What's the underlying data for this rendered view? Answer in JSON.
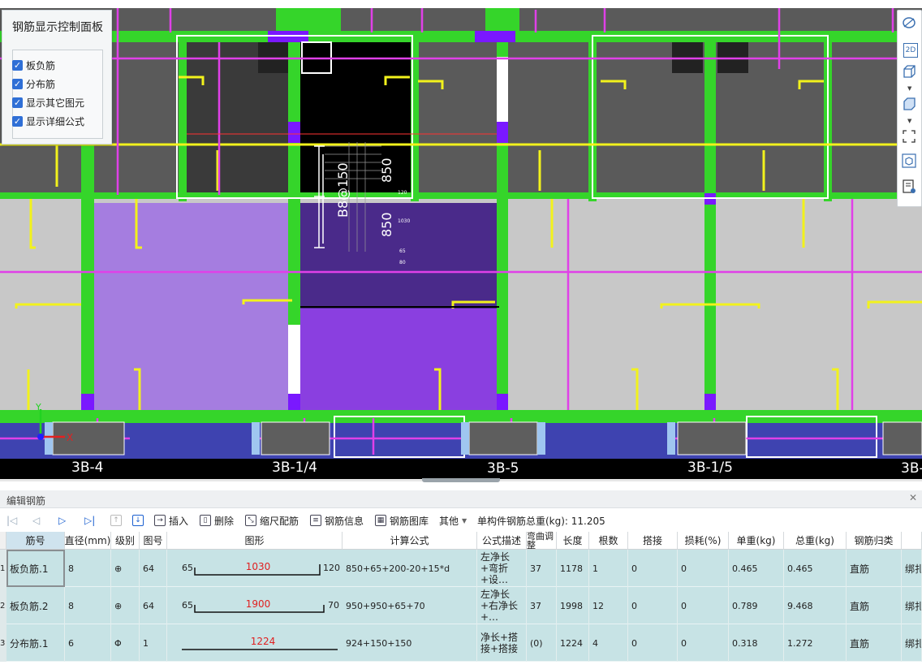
{
  "panel": {
    "title": "钢筋显示控制面板",
    "options": [
      {
        "label": "板负筋",
        "checked": true
      },
      {
        "label": "分布筋",
        "checked": true
      },
      {
        "label": "显示其它图元",
        "checked": true
      },
      {
        "label": "显示详细公式",
        "checked": true
      }
    ]
  },
  "viewport": {
    "axis_labels": [
      "3B-4",
      "3B-1/4",
      "3B-5",
      "3B-1/5",
      "3B-"
    ],
    "dims": [
      "850",
      "850",
      "B8@150",
      "120",
      "1030",
      "65",
      "80"
    ],
    "triad": {
      "x": "X",
      "y": "Y"
    }
  },
  "view_toolbar": {
    "items": [
      "orbit-icon",
      "2d-view-icon",
      "3d-box-icon",
      "3d-solid-icon",
      "fullscreen-icon",
      "object-view-icon",
      "list-view-icon"
    ],
    "label_2d": "2D"
  },
  "editor": {
    "title": "编辑钢筋",
    "toolbar": {
      "insert": "插入",
      "delete": "删除",
      "scale": "缩尺配筋",
      "info": "钢筋信息",
      "library": "钢筋图库",
      "other": "其他",
      "total_weight": "单构件钢筋总重(kg): 11.205"
    },
    "columns": [
      "筋号",
      "直径(mm)",
      "级别",
      "图号",
      "图形",
      "计算公式",
      "公式描述",
      "弯曲调整",
      "长度",
      "根数",
      "搭接",
      "损耗(%)",
      "单重(kg)",
      "总重(kg)",
      "钢筋归类",
      ""
    ],
    "rows": [
      {
        "num": "1",
        "name": "板负筋.1",
        "diameter": "8",
        "grade": "⊕",
        "fig": "64",
        "shape_left": "65",
        "shape_mid": "1030",
        "shape_right": "120",
        "formula": "850+65+200-20+15*d",
        "desc": "左净长+弯折+设…",
        "bend": "37",
        "length": "1178",
        "count": "1",
        "lap": "0",
        "loss": "0",
        "unit_w": "0.465",
        "total_w": "0.465",
        "category": "直筋",
        "extra": "绑扎"
      },
      {
        "num": "2",
        "name": "板负筋.2",
        "diameter": "8",
        "grade": "⊕",
        "fig": "64",
        "shape_left": "65",
        "shape_mid": "1900",
        "shape_right": "70",
        "formula": "950+950+65+70",
        "desc": "左净长+右净长+…",
        "bend": "37",
        "length": "1998",
        "count": "12",
        "lap": "0",
        "loss": "0",
        "unit_w": "0.789",
        "total_w": "9.468",
        "category": "直筋",
        "extra": "绑扎"
      },
      {
        "num": "3",
        "name": "分布筋.1",
        "diameter": "6",
        "grade": "Φ",
        "fig": "1",
        "shape_left": "",
        "shape_mid": "1224",
        "shape_right": "",
        "formula": "924+150+150",
        "desc": "净长+搭接+搭接",
        "bend": "(0)",
        "length": "1224",
        "count": "4",
        "lap": "0",
        "loss": "0",
        "unit_w": "0.318",
        "total_w": "1.272",
        "category": "直筋",
        "extra": "绑扎"
      }
    ]
  },
  "colors": {
    "green": "#35d52a",
    "magenta": "#e040e8",
    "yellow": "#f2f21c",
    "purple": "#8a3fe0",
    "row_bg": "#c7e3e5"
  }
}
